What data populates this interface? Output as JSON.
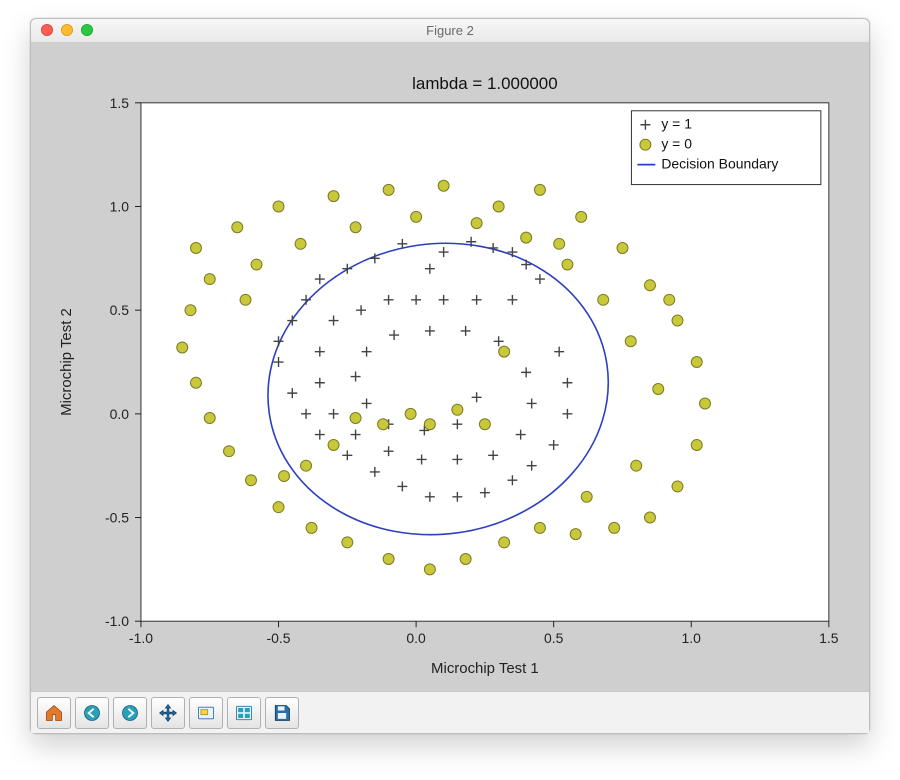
{
  "window": {
    "title": "Figure 2"
  },
  "toolbar": {
    "home": "Home",
    "back": "Back",
    "forward": "Forward",
    "pan": "Pan",
    "zoom": "Zoom",
    "config": "Configure subplots",
    "save": "Save"
  },
  "chart_data": {
    "type": "scatter",
    "title": "lambda = 1.000000",
    "xlabel": "Microchip Test 1",
    "ylabel": "Microchip Test 2",
    "xlim": [
      -1.0,
      1.5
    ],
    "ylim": [
      -1.0,
      1.5
    ],
    "xticks": [
      -1.0,
      -0.5,
      0.0,
      0.5,
      1.0,
      1.5
    ],
    "yticks": [
      -1.0,
      -0.5,
      0.0,
      0.5,
      1.0,
      1.5
    ],
    "legend": {
      "position": "upper right",
      "entries": [
        {
          "label": "y = 1",
          "marker": "plus",
          "color": "#444444"
        },
        {
          "label": "y = 0",
          "marker": "circle",
          "color": "#c8c83a"
        },
        {
          "label": "Decision Boundary",
          "marker": "line",
          "color": "#2b3fbf"
        }
      ]
    },
    "series": [
      {
        "name": "y = 1",
        "marker": "plus",
        "color": "#444444",
        "points": [
          [
            0.05,
            0.7
          ],
          [
            0.1,
            0.78
          ],
          [
            0.2,
            0.83
          ],
          [
            0.28,
            0.8
          ],
          [
            0.35,
            0.78
          ],
          [
            0.4,
            0.72
          ],
          [
            0.45,
            0.65
          ],
          [
            -0.05,
            0.82
          ],
          [
            -0.15,
            0.75
          ],
          [
            -0.25,
            0.7
          ],
          [
            -0.35,
            0.65
          ],
          [
            -0.4,
            0.55
          ],
          [
            -0.45,
            0.45
          ],
          [
            -0.5,
            0.35
          ],
          [
            -0.5,
            0.25
          ],
          [
            -0.45,
            0.1
          ],
          [
            -0.4,
            0.0
          ],
          [
            -0.35,
            -0.1
          ],
          [
            -0.25,
            -0.2
          ],
          [
            -0.15,
            -0.28
          ],
          [
            -0.05,
            -0.35
          ],
          [
            0.05,
            -0.4
          ],
          [
            0.15,
            -0.4
          ],
          [
            0.25,
            -0.38
          ],
          [
            0.35,
            -0.32
          ],
          [
            0.42,
            -0.25
          ],
          [
            0.5,
            -0.15
          ],
          [
            0.55,
            0.0
          ],
          [
            0.55,
            0.15
          ],
          [
            0.52,
            0.3
          ],
          [
            0.0,
            0.55
          ],
          [
            0.1,
            0.55
          ],
          [
            0.22,
            0.55
          ],
          [
            0.35,
            0.55
          ],
          [
            -0.1,
            0.55
          ],
          [
            -0.2,
            0.5
          ],
          [
            -0.3,
            0.45
          ],
          [
            -0.35,
            0.3
          ],
          [
            -0.35,
            0.15
          ],
          [
            -0.3,
            0.0
          ],
          [
            -0.22,
            -0.1
          ],
          [
            -0.1,
            -0.18
          ],
          [
            0.02,
            -0.22
          ],
          [
            0.15,
            -0.22
          ],
          [
            0.28,
            -0.2
          ],
          [
            0.38,
            -0.1
          ],
          [
            0.42,
            0.05
          ],
          [
            0.4,
            0.2
          ],
          [
            0.3,
            0.35
          ],
          [
            0.18,
            0.4
          ],
          [
            0.05,
            0.4
          ],
          [
            -0.08,
            0.38
          ],
          [
            -0.18,
            0.3
          ],
          [
            -0.22,
            0.18
          ],
          [
            -0.18,
            0.05
          ],
          [
            -0.1,
            -0.05
          ],
          [
            0.03,
            -0.08
          ],
          [
            0.15,
            -0.05
          ],
          [
            0.22,
            0.08
          ]
        ]
      },
      {
        "name": "y = 0",
        "marker": "circle",
        "color": "#c8c83a",
        "points": [
          [
            -0.8,
            0.8
          ],
          [
            -0.65,
            0.9
          ],
          [
            -0.5,
            1.0
          ],
          [
            -0.3,
            1.05
          ],
          [
            -0.1,
            1.08
          ],
          [
            0.1,
            1.1
          ],
          [
            0.3,
            1.0
          ],
          [
            0.45,
            1.08
          ],
          [
            0.6,
            0.95
          ],
          [
            0.75,
            0.8
          ],
          [
            0.85,
            0.62
          ],
          [
            0.95,
            0.45
          ],
          [
            1.02,
            0.25
          ],
          [
            1.05,
            0.05
          ],
          [
            1.02,
            -0.15
          ],
          [
            0.95,
            -0.35
          ],
          [
            0.85,
            -0.5
          ],
          [
            0.72,
            -0.55
          ],
          [
            0.58,
            -0.58
          ],
          [
            0.45,
            -0.55
          ],
          [
            0.32,
            -0.62
          ],
          [
            0.18,
            -0.7
          ],
          [
            0.05,
            -0.75
          ],
          [
            -0.1,
            -0.7
          ],
          [
            -0.25,
            -0.62
          ],
          [
            -0.38,
            -0.55
          ],
          [
            -0.5,
            -0.45
          ],
          [
            -0.6,
            -0.32
          ],
          [
            -0.68,
            -0.18
          ],
          [
            -0.75,
            -0.02
          ],
          [
            -0.8,
            0.15
          ],
          [
            -0.85,
            0.32
          ],
          [
            -0.82,
            0.5
          ],
          [
            -0.75,
            0.65
          ],
          [
            0.88,
            0.12
          ],
          [
            0.78,
            0.35
          ],
          [
            0.68,
            0.55
          ],
          [
            0.55,
            0.72
          ],
          [
            0.4,
            0.85
          ],
          [
            0.22,
            0.92
          ],
          [
            -0.58,
            0.72
          ],
          [
            -0.42,
            0.82
          ],
          [
            -0.22,
            0.9
          ],
          [
            0.0,
            0.95
          ],
          [
            -0.02,
            0.0
          ],
          [
            -0.12,
            -0.05
          ],
          [
            -0.22,
            -0.02
          ],
          [
            -0.3,
            -0.15
          ],
          [
            -0.4,
            -0.25
          ],
          [
            0.05,
            -0.05
          ],
          [
            0.15,
            0.02
          ],
          [
            0.25,
            -0.05
          ],
          [
            0.32,
            0.3
          ],
          [
            -0.48,
            -0.3
          ],
          [
            0.62,
            -0.4
          ],
          [
            0.52,
            0.82
          ],
          [
            -0.62,
            0.55
          ],
          [
            0.8,
            -0.25
          ],
          [
            0.92,
            0.55
          ]
        ]
      }
    ],
    "decision_boundary": {
      "color": "#2b3fbf",
      "ellipse": {
        "cx": 0.08,
        "cy": 0.12,
        "rx": 0.62,
        "ry": 0.7,
        "rotation_deg": -8
      }
    }
  }
}
